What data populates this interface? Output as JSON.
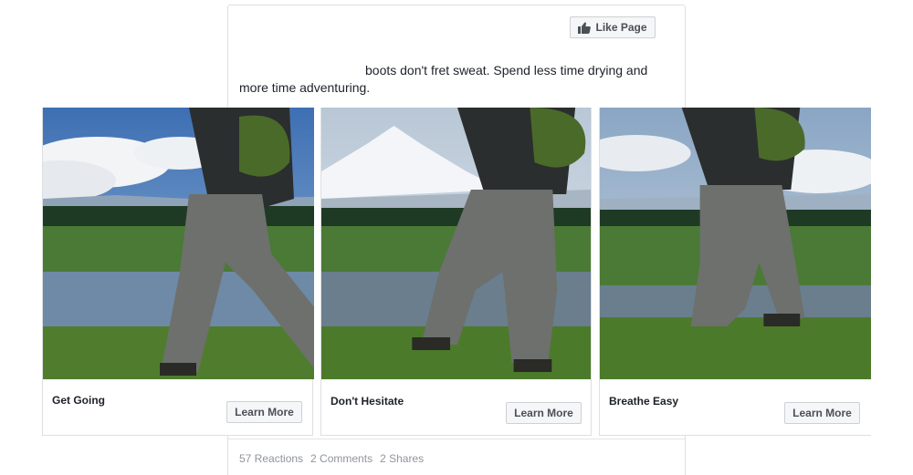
{
  "post": {
    "like_page_label": "Like Page",
    "text_line1": "boots don't fret sweat. Spend less time drying and",
    "text_line2": "more time adventuring."
  },
  "carousel": {
    "cards": [
      {
        "title": "Get Going",
        "button_label": "Learn More"
      },
      {
        "title": "Don't Hesitate",
        "button_label": "Learn More"
      },
      {
        "title": "Breathe Easy",
        "button_label": "Learn More"
      }
    ]
  },
  "stats": {
    "reactions": "57 Reactions",
    "comments": "2 Comments",
    "shares": "2 Shares"
  },
  "colors": {
    "button_bg": "#f5f6f7",
    "border": "#dddfe2",
    "muted_text": "#90949c"
  }
}
